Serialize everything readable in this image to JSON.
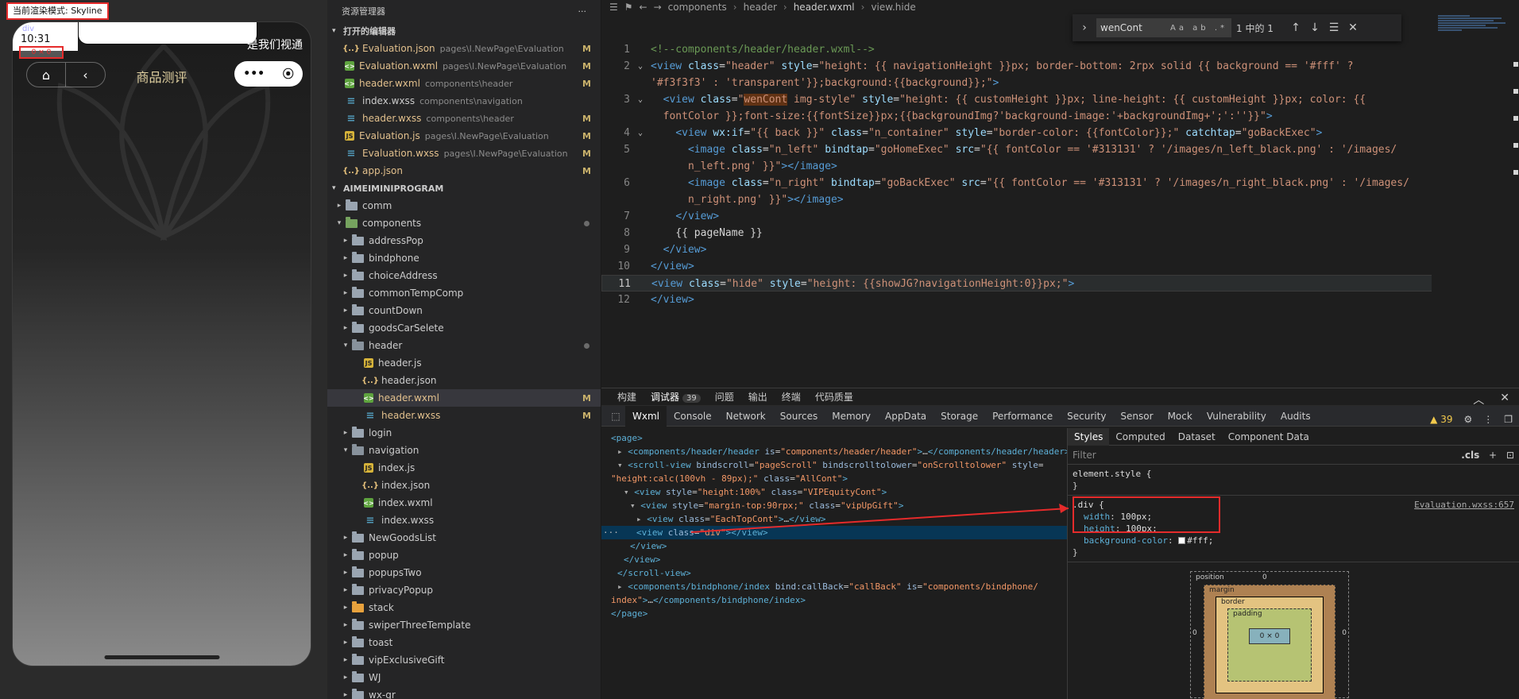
{
  "simulator": {
    "render_mode": "当前渲染模式: Skyline",
    "status_time": "10:31",
    "status_label": "div",
    "div_label": "0 × 0",
    "status_right_text": "是我们视通",
    "page_name": "商品测评",
    "menu_dots": "•••",
    "menu_target": "⦿",
    "home_icon": "⌂",
    "back_icon": "‹"
  },
  "explorer": {
    "title": "资源管理器",
    "more": "···",
    "open_editors_label": "打开的编辑器",
    "project_label": "AIMEIMINIPROGRAM",
    "open_editors": [
      {
        "name": "Evaluation.json",
        "path": "pages\\I.NewPage\\Evaluation",
        "mod": "M",
        "type": "json"
      },
      {
        "name": "Evaluation.wxml",
        "path": "pages\\I.NewPage\\Evaluation",
        "mod": "M",
        "type": "wxml"
      },
      {
        "name": "header.wxml",
        "path": "components\\header",
        "mod": "M",
        "type": "wxml"
      },
      {
        "name": "index.wxss",
        "path": "components\\navigation",
        "mod": "",
        "type": "wxss"
      },
      {
        "name": "header.wxss",
        "path": "components\\header",
        "mod": "M",
        "type": "wxss"
      },
      {
        "name": "Evaluation.js",
        "path": "pages\\I.NewPage\\Evaluation",
        "mod": "M",
        "type": "js"
      },
      {
        "name": "Evaluation.wxss",
        "path": "pages\\I.NewPage\\Evaluation",
        "mod": "M",
        "type": "wxss"
      },
      {
        "name": "app.json",
        "path": "",
        "mod": "M",
        "type": "json"
      }
    ],
    "tree": [
      {
        "name": "comm",
        "depth": 1,
        "kind": "folder",
        "open": false
      },
      {
        "name": "components",
        "depth": 1,
        "kind": "folder-green",
        "open": true,
        "dot": true
      },
      {
        "name": "addressPop",
        "depth": 2,
        "kind": "folder",
        "open": false
      },
      {
        "name": "bindphone",
        "depth": 2,
        "kind": "folder",
        "open": false
      },
      {
        "name": "choiceAddress",
        "depth": 2,
        "kind": "folder",
        "open": false
      },
      {
        "name": "commonTempComp",
        "depth": 2,
        "kind": "folder",
        "open": false
      },
      {
        "name": "countDown",
        "depth": 2,
        "kind": "folder",
        "open": false
      },
      {
        "name": "goodsCarSelete",
        "depth": 2,
        "kind": "folder",
        "open": false
      },
      {
        "name": "header",
        "depth": 2,
        "kind": "folder",
        "open": true,
        "dot": true,
        "modified": true
      },
      {
        "name": "header.js",
        "depth": 3,
        "kind": "js"
      },
      {
        "name": "header.json",
        "depth": 3,
        "kind": "json"
      },
      {
        "name": "header.wxml",
        "depth": 3,
        "kind": "wxml",
        "mod": "M",
        "active": true
      },
      {
        "name": "header.wxss",
        "depth": 3,
        "kind": "wxss",
        "mod": "M"
      },
      {
        "name": "login",
        "depth": 2,
        "kind": "folder",
        "open": false
      },
      {
        "name": "navigation",
        "depth": 2,
        "kind": "folder",
        "open": true
      },
      {
        "name": "index.js",
        "depth": 3,
        "kind": "js"
      },
      {
        "name": "index.json",
        "depth": 3,
        "kind": "json"
      },
      {
        "name": "index.wxml",
        "depth": 3,
        "kind": "wxml"
      },
      {
        "name": "index.wxss",
        "depth": 3,
        "kind": "wxss"
      },
      {
        "name": "NewGoodsList",
        "depth": 2,
        "kind": "folder",
        "open": false
      },
      {
        "name": "popup",
        "depth": 2,
        "kind": "folder",
        "open": false
      },
      {
        "name": "popupsTwo",
        "depth": 2,
        "kind": "folder",
        "open": false
      },
      {
        "name": "privacyPopup",
        "depth": 2,
        "kind": "folder",
        "open": false
      },
      {
        "name": "stack",
        "depth": 2,
        "kind": "folder-orange",
        "open": false
      },
      {
        "name": "swiperThreeTemplate",
        "depth": 2,
        "kind": "folder",
        "open": false
      },
      {
        "name": "toast",
        "depth": 2,
        "kind": "folder",
        "open": false
      },
      {
        "name": "vipExclusiveGift",
        "depth": 2,
        "kind": "folder",
        "open": false
      },
      {
        "name": "WJ",
        "depth": 2,
        "kind": "folder",
        "open": false
      },
      {
        "name": "wx-gr",
        "depth": 2,
        "kind": "folder",
        "open": false
      }
    ]
  },
  "editor": {
    "breadcrumb": [
      "components",
      "header",
      "header.wxml",
      "view.hide"
    ],
    "find": {
      "query": "wenCont",
      "options": "Aa ab .*",
      "count": "1 中的 1",
      "prev": "↑",
      "next": "↓",
      "menu": "☰",
      "close": "✕"
    },
    "lines": [
      {
        "n": "1",
        "segs": [
          [
            "c-com",
            "<!--components/header/header.wxml-->"
          ]
        ]
      },
      {
        "n": "2",
        "fold": "⌄",
        "segs": [
          [
            "c-tag",
            "<view "
          ],
          [
            "c-attr",
            "class"
          ],
          [
            "c-txt",
            "="
          ],
          [
            "c-str",
            "\"header\" "
          ],
          [
            "c-attr",
            "style"
          ],
          [
            "c-txt",
            "="
          ],
          [
            "c-str",
            "\"height: {{ navigationHeight }}px; border-bottom: 2rpx solid {{ background == '#fff' ?"
          ]
        ]
      },
      {
        "n": "",
        "segs": [
          [
            "c-str",
            "'#f3f3f3' : 'transparent'}};background:{{background}};\""
          ],
          [
            "c-tag",
            ">"
          ]
        ]
      },
      {
        "n": "3",
        "fold": "⌄",
        "segs": [
          [
            "c-txt",
            "  "
          ],
          [
            "c-tag",
            "<view "
          ],
          [
            "c-attr",
            "class"
          ],
          [
            "c-txt",
            "="
          ],
          [
            "c-str",
            "\""
          ],
          [
            "c-hl",
            "wenCont"
          ],
          [
            "c-str",
            " img-style\" "
          ],
          [
            "c-attr",
            "style"
          ],
          [
            "c-txt",
            "="
          ],
          [
            "c-str",
            "\"height: {{ customHeight }}px; line-height: {{ customHeight }}px; color: {{"
          ]
        ]
      },
      {
        "n": "",
        "segs": [
          [
            "c-str",
            "  fontColor }};font-size:{{fontSize}}px;{{backgroundImg?'background-image:'+backgroundImg+';':''}}\""
          ],
          [
            "c-tag",
            ">"
          ]
        ]
      },
      {
        "n": "4",
        "fold": "⌄",
        "segs": [
          [
            "c-txt",
            "    "
          ],
          [
            "c-tag",
            "<view "
          ],
          [
            "c-attr",
            "wx:if"
          ],
          [
            "c-txt",
            "="
          ],
          [
            "c-str",
            "\"{{ back }}\" "
          ],
          [
            "c-attr",
            "class"
          ],
          [
            "c-txt",
            "="
          ],
          [
            "c-str",
            "\"n_container\" "
          ],
          [
            "c-attr",
            "style"
          ],
          [
            "c-txt",
            "="
          ],
          [
            "c-str",
            "\"border-color: {{fontColor}};\" "
          ],
          [
            "c-attr",
            "catchtap"
          ],
          [
            "c-txt",
            "="
          ],
          [
            "c-str",
            "\"goBackExec\""
          ],
          [
            "c-tag",
            ">"
          ]
        ]
      },
      {
        "n": "5",
        "segs": [
          [
            "c-txt",
            "      "
          ],
          [
            "c-tag",
            "<image "
          ],
          [
            "c-attr",
            "class"
          ],
          [
            "c-txt",
            "="
          ],
          [
            "c-str",
            "\"n_left\" "
          ],
          [
            "c-attr",
            "bindtap"
          ],
          [
            "c-txt",
            "="
          ],
          [
            "c-str",
            "\"goHomeExec\" "
          ],
          [
            "c-attr",
            "src"
          ],
          [
            "c-txt",
            "="
          ],
          [
            "c-str",
            "\"{{ fontColor == '#313131' ? '/images/n_left_black.png' : '/images/"
          ]
        ]
      },
      {
        "n": "",
        "segs": [
          [
            "c-str",
            "      n_left.png' }}\""
          ],
          [
            "c-tag",
            "></image>"
          ]
        ]
      },
      {
        "n": "6",
        "segs": [
          [
            "c-txt",
            "      "
          ],
          [
            "c-tag",
            "<image "
          ],
          [
            "c-attr",
            "class"
          ],
          [
            "c-txt",
            "="
          ],
          [
            "c-str",
            "\"n_right\" "
          ],
          [
            "c-attr",
            "bindtap"
          ],
          [
            "c-txt",
            "="
          ],
          [
            "c-str",
            "\"goBackExec\" "
          ],
          [
            "c-attr",
            "src"
          ],
          [
            "c-txt",
            "="
          ],
          [
            "c-str",
            "\"{{ fontColor == '#313131' ? '/images/n_right_black.png' : '/images/"
          ]
        ]
      },
      {
        "n": "",
        "segs": [
          [
            "c-str",
            "      n_right.png' }}\""
          ],
          [
            "c-tag",
            "></image>"
          ]
        ]
      },
      {
        "n": "7",
        "segs": [
          [
            "c-txt",
            "    "
          ],
          [
            "c-tag",
            "</view>"
          ]
        ]
      },
      {
        "n": "8",
        "segs": [
          [
            "c-txt",
            "    {{ pageName }}"
          ]
        ]
      },
      {
        "n": "9",
        "segs": [
          [
            "c-txt",
            "  "
          ],
          [
            "c-tag",
            "</view>"
          ]
        ]
      },
      {
        "n": "10",
        "segs": [
          [
            "c-tag",
            "</view>"
          ]
        ]
      },
      {
        "n": "11",
        "current": true,
        "segs": [
          [
            "c-tag",
            "<view "
          ],
          [
            "c-attr",
            "class"
          ],
          [
            "c-txt",
            "="
          ],
          [
            "c-str",
            "\"hide\" "
          ],
          [
            "c-attr",
            "style"
          ],
          [
            "c-txt",
            "="
          ],
          [
            "c-str",
            "\"height: {{showJG?navigationHeight:0}}px;\""
          ],
          [
            "c-tag",
            ">"
          ]
        ]
      },
      {
        "n": "12",
        "segs": [
          [
            "c-tag",
            "</view>"
          ]
        ]
      }
    ]
  },
  "devtools": {
    "top_tabs": [
      "构建",
      "调试器",
      "问题",
      "输出",
      "终端",
      "代码质量"
    ],
    "active_top_tab": "调试器",
    "debugger_badge": "39",
    "panel_tabs": [
      "Wxml",
      "Console",
      "Network",
      "Sources",
      "Memory",
      "AppData",
      "Storage",
      "Performance",
      "Security",
      "Sensor",
      "Mock",
      "Vulnerability",
      "Audits"
    ],
    "active_panel_tab": "Wxml",
    "warning_count": "39",
    "tree": [
      {
        "indent": 0,
        "selected": false,
        "segs": [
          [
            "t-tag",
            "<page>"
          ]
        ]
      },
      {
        "indent": 1,
        "arrow": "▸",
        "segs": [
          [
            "t-tag",
            "<components/header/header "
          ],
          [
            "t-attr",
            "is"
          ],
          [
            "t-txt",
            "="
          ],
          [
            "t-val",
            "\"components/header/header\""
          ],
          [
            "t-tag",
            ">"
          ],
          [
            "t-txt",
            "…"
          ],
          [
            "t-tag",
            "</components/header/header>"
          ]
        ]
      },
      {
        "indent": 1,
        "arrow": "▾",
        "segs": [
          [
            "t-tag",
            "<scroll-view "
          ],
          [
            "t-attr",
            "bindscroll"
          ],
          [
            "t-txt",
            "="
          ],
          [
            "t-val",
            "\"pageScroll\" "
          ],
          [
            "t-attr",
            "bindscrolltolower"
          ],
          [
            "t-txt",
            "="
          ],
          [
            "t-val",
            "\"onScrolltolower\" "
          ],
          [
            "t-attr",
            "style"
          ],
          [
            "t-txt",
            "="
          ]
        ]
      },
      {
        "indent": 0,
        "segs": [
          [
            "t-val",
            "\"height:calc(100vh - 89px);\" "
          ],
          [
            "t-attr",
            "class"
          ],
          [
            "t-txt",
            "="
          ],
          [
            "t-val",
            "\"AllCont\""
          ],
          [
            "t-tag",
            ">"
          ]
        ]
      },
      {
        "indent": 2,
        "arrow": "▾",
        "segs": [
          [
            "t-tag",
            "<view "
          ],
          [
            "t-attr",
            "style"
          ],
          [
            "t-txt",
            "="
          ],
          [
            "t-val",
            "\"height:100%\" "
          ],
          [
            "t-attr",
            "class"
          ],
          [
            "t-txt",
            "="
          ],
          [
            "t-val",
            "\"VIPEquityCont\""
          ],
          [
            "t-tag",
            ">"
          ]
        ]
      },
      {
        "indent": 3,
        "arrow": "▾",
        "segs": [
          [
            "t-tag",
            "<view "
          ],
          [
            "t-attr",
            "style"
          ],
          [
            "t-txt",
            "="
          ],
          [
            "t-val",
            "\"margin-top:90rpx;\" "
          ],
          [
            "t-attr",
            "class"
          ],
          [
            "t-txt",
            "="
          ],
          [
            "t-val",
            "\"vipUpGift\""
          ],
          [
            "t-tag",
            ">"
          ]
        ]
      },
      {
        "indent": 4,
        "arrow": "▸",
        "segs": [
          [
            "t-tag",
            "<view "
          ],
          [
            "t-attr",
            "class"
          ],
          [
            "t-txt",
            "="
          ],
          [
            "t-val",
            "\"EachTopCont\""
          ],
          [
            "t-tag",
            ">"
          ],
          [
            "t-txt",
            "…"
          ],
          [
            "t-tag",
            "</view>"
          ]
        ]
      },
      {
        "indent": 4,
        "selected": true,
        "segs": [
          [
            "t-tag",
            "<view "
          ],
          [
            "t-attr",
            "class"
          ],
          [
            "t-txt",
            "="
          ],
          [
            "t-val",
            "\"div\""
          ],
          [
            "t-tag",
            "></view>"
          ]
        ]
      },
      {
        "indent": 3,
        "segs": [
          [
            "t-tag",
            "</view>"
          ]
        ]
      },
      {
        "indent": 2,
        "segs": [
          [
            "t-tag",
            "</view>"
          ]
        ]
      },
      {
        "indent": 1,
        "segs": [
          [
            "t-tag",
            "</scroll-view>"
          ]
        ]
      },
      {
        "indent": 1,
        "arrow": "▸",
        "segs": [
          [
            "t-tag",
            "<components/bindphone/index "
          ],
          [
            "t-attr",
            "bind:callBack"
          ],
          [
            "t-txt",
            "="
          ],
          [
            "t-val",
            "\"callBack\" "
          ],
          [
            "t-attr",
            "is"
          ],
          [
            "t-txt",
            "="
          ],
          [
            "t-val",
            "\"components/bindphone/"
          ]
        ]
      },
      {
        "indent": 0,
        "segs": [
          [
            "t-val",
            "index\""
          ],
          [
            "t-tag",
            ">"
          ],
          [
            "t-txt",
            "…"
          ],
          [
            "t-tag",
            "</components/bindphone/index>"
          ]
        ]
      },
      {
        "indent": 0,
        "segs": [
          [
            "t-tag",
            "</page>"
          ]
        ]
      }
    ],
    "styles": {
      "tabs": [
        "Styles",
        "Computed",
        "Dataset",
        "Component Data"
      ],
      "active_tab": "Styles",
      "filter_placeholder": "Filter",
      "cls": ".cls",
      "plus": "+",
      "element_style_open": "element.style {",
      "close_brace": "}",
      "div_selector": ".div {",
      "div_source": "Evaluation.wxss:657",
      "props": [
        {
          "name": "width",
          "value": "100px;"
        },
        {
          "name": "height",
          "value": "100px;"
        },
        {
          "name": "background-color",
          "value": "#fff;"
        }
      ],
      "box_model": {
        "position_label": "position",
        "position_value": "0",
        "margin_label": "margin",
        "border_label": "border",
        "padding_label": "padding",
        "dash": "–",
        "content": "0 × 0",
        "left_value": "0",
        "right_value": "0"
      }
    }
  },
  "colors": {
    "accent_red": "#e52b2b",
    "selection_blue": "#073655",
    "modified_yellow": "#e2c08d"
  }
}
